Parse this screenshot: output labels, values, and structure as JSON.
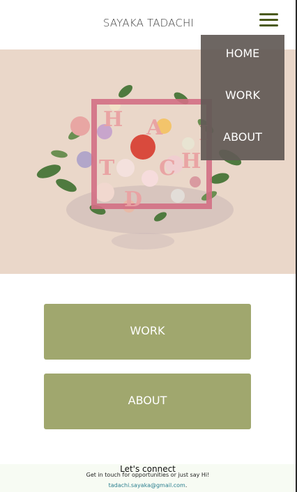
{
  "header": {
    "title": "SAYAKA TADACHI",
    "menu_icon": "hamburger-menu-icon"
  },
  "menu": {
    "items": [
      {
        "label": "HOME"
      },
      {
        "label": "WORK"
      },
      {
        "label": "ABOUT"
      }
    ]
  },
  "hero": {
    "logo_letters": [
      "H",
      "A",
      "T",
      "D",
      "C",
      "H",
      "I"
    ]
  },
  "buttons": {
    "work": "WORK",
    "about": "ABOUT"
  },
  "footer": {
    "heading": "Let's connect",
    "subtext": "Get in touch for opportunities or just say Hi!",
    "email": "tadachi.sayaka@gmail.com",
    "email_suffix": "."
  },
  "colors": {
    "accent": "#a0a76e",
    "hero_bg": "#ead7c9",
    "menu_overlay": "#625a56",
    "icon": "#4a5a1a",
    "logo_pink": "#d36f84",
    "footer_bg": "#f7fbf3",
    "email_link": "#2b7f8f"
  }
}
